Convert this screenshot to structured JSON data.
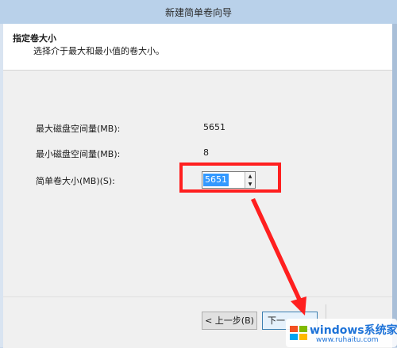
{
  "window": {
    "title": "新建简单卷向导"
  },
  "header": {
    "title": "指定卷大小",
    "subtitle": "选择介于最大和最小值的卷大小。"
  },
  "rows": [
    {
      "label": "最大磁盘空间量(MB):",
      "value": "5651"
    },
    {
      "label": "最小磁盘空间量(MB):",
      "value": "8"
    }
  ],
  "size_field": {
    "label": "简单卷大小(MB)(S):",
    "value": "5651"
  },
  "buttons": {
    "back": "< 上一步(B)",
    "next": "下一"
  },
  "watermark": {
    "title": "windows系统家园",
    "url": "www.ruhaitu.com"
  },
  "colors": {
    "highlight": "#ff1f1f",
    "selection": "#3399ff",
    "brand": "#1e73d8"
  }
}
